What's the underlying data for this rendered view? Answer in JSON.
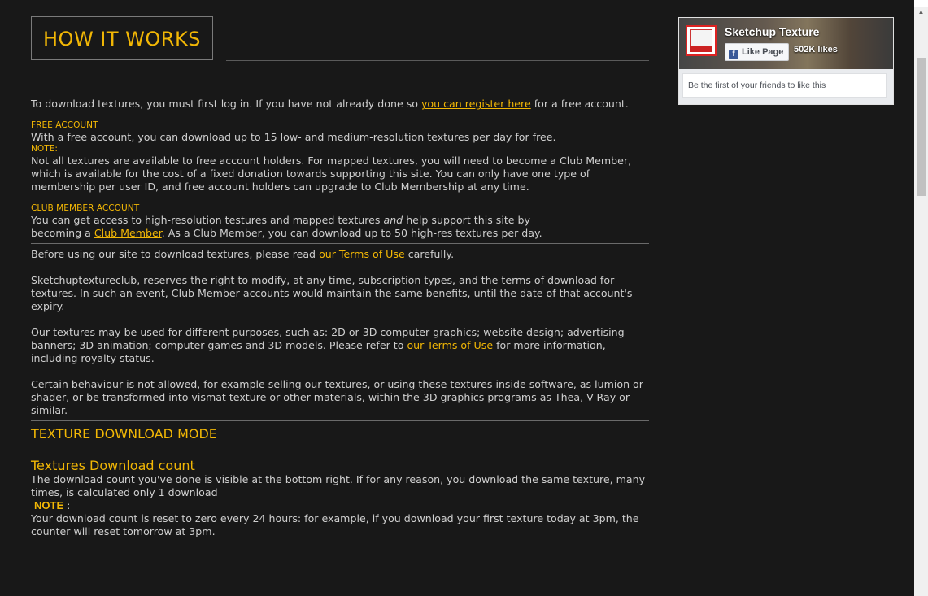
{
  "header": {
    "title": "HOW IT WORKS"
  },
  "intro": {
    "before": "To download textures, you must first log in. If you have not already done so ",
    "link": "you can register here",
    "after": " for a free account."
  },
  "free_account": {
    "label": "FREE ACCOUNT",
    "text": "With a free account, you can download up to 15 low- and medium-resolution textures per day for free.",
    "note_label": "NOTE:",
    "note_text": "Not all textures are available to free account holders. For mapped textures, you will need to become a Club Member, which is available for the cost of a fixed donation towards supporting this site. You can only have one type of membership per user ID, and free account holders can upgrade to Club Membership at any time."
  },
  "club_account": {
    "label": "CLUB MEMBER ACCOUNT",
    "text_before": "You can get access to high-resolution testures and mapped textures ",
    "text_em": "and",
    "text_mid": " help support this site by becoming a ",
    "link": "Club Member",
    "text_after": ". As a Club Member, you can download up to 50 high-res textures per day."
  },
  "terms": {
    "before": "Before using our site to download textures, please read ",
    "link": "our Terms of Use",
    "after": " carefully."
  },
  "rights_text": "Sketchuptextureclub, reserves the right to modify, at any time, subscription types, and the terms of download for textures. In such an event, Club Member accounts would maintain the same benefits, until the date of that account's expiry.",
  "usage": {
    "before": "Our textures may be used for different purposes, such as: 2D or 3D computer graphics; website design; advertising banners; 3D animation; computer games and 3D models. Please refer to ",
    "link": "our Terms of Use",
    "after": " for more information, including royalty status."
  },
  "behaviour_text": "Certain behaviour is not allowed, for example selling our textures, or using these textures inside software, as lumion or shader, or be transformed into vismat texture or other materials, within the 3D graphics programs as Thea, V-Ray or similar.",
  "download_mode": {
    "heading": "TEXTURE DOWNLOAD MODE",
    "subheading": "Textures Download count",
    "text": "The download count you've done is visible at the bottom right. If for any reason, you download the same texture, many times, is calculated only 1 download",
    "note_label": "NOTE",
    "note_suffix": " :",
    "note_text": "Your download count is reset to zero every 24 hours: for example, if you download your first texture today at 3pm, the counter will reset tomorrow at 3pm."
  },
  "facebook": {
    "page_name": "Sketchup Texture",
    "like_button": "Like Page",
    "likes": "502K likes",
    "friends_text": "Be the first of your friends to like this",
    "logo_icon": "sketchup-texture-logo",
    "fb_icon": "facebook-f-icon"
  },
  "colors": {
    "accent": "#f2b705",
    "background": "#181818",
    "text": "#cfcfcf"
  }
}
